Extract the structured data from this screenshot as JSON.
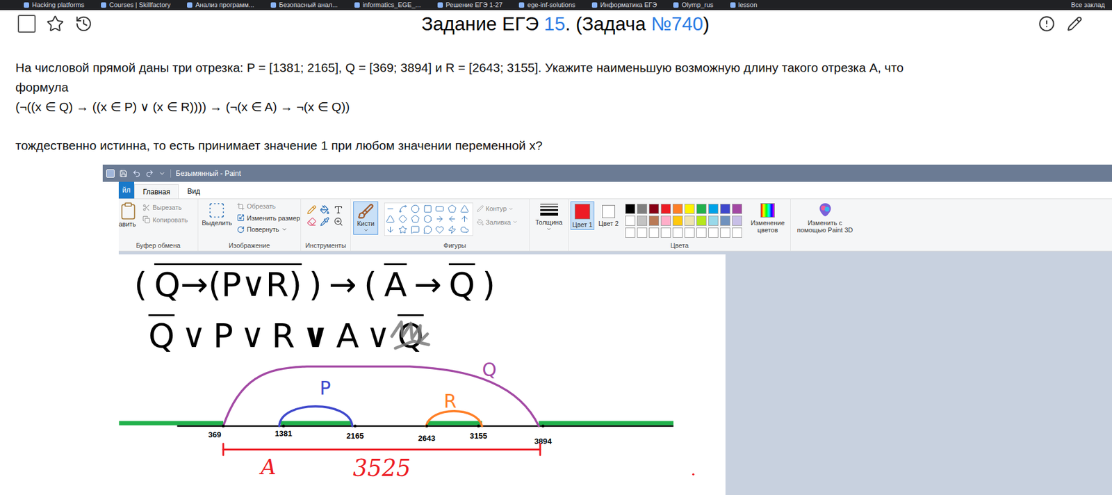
{
  "browser": {
    "bookmarks": [
      "Hacking platforms",
      "Courses | Skillfactory",
      "Анализ программ...",
      "Безопасный анал...",
      "informatics_EGE_...",
      "Решение ЕГЭ 1-27",
      "ege-inf-solutions",
      "Информатика ЕГЭ",
      "Olymp_rus",
      "lesson"
    ],
    "all_bookmarks": "Все заклад"
  },
  "page": {
    "title_prefix": "Задание ЕГЭ ",
    "title_number": "15",
    "title_middle": ". (Задача ",
    "title_task": "№740",
    "title_suffix": ")",
    "problem_lines": [
      "На числовой прямой даны три отрезка: P = [1381; 2165], Q = [369; 3894] и R = [2643; 3155]. Укажите наименьшую возможную длину такого отрезка A, что",
      "формула",
      "(¬((x ∈ Q) → ((x ∈ P) ∨ (x ∈ R)))) → (¬(x ∈ A) → ¬(x ∈ Q))"
    ],
    "question": "тождественно истинна, то есть принимает значение 1 при любом значении переменной x?",
    "checked": false
  },
  "paint": {
    "title": "Безымянный - Paint",
    "tabs": [
      {
        "label": "йл",
        "selected": false,
        "kind": "file"
      },
      {
        "label": "Главная",
        "selected": true,
        "kind": "tab"
      },
      {
        "label": "Вид",
        "selected": false,
        "kind": "tab"
      }
    ],
    "clipboard": {
      "label": "Буфер обмена",
      "paste": "авить",
      "cut": "Вырезать",
      "copy": "Копировать"
    },
    "image": {
      "label": "Изображение",
      "select": "Выделить",
      "crop": "Обрезать",
      "resize": "Изменить размер",
      "rotate": "Повернуть"
    },
    "tools": {
      "label": "Инструменты"
    },
    "brushes": {
      "label": "Кисти",
      "selected": true
    },
    "shapes": {
      "label": "Фигуры",
      "outline": "Контур",
      "fill": "Заливка"
    },
    "size": {
      "label": "Толщина"
    },
    "colors": {
      "label": "Цвета",
      "color1": {
        "label": "Цвет 1",
        "color": "#ed1c24",
        "selected": true
      },
      "color2": {
        "label": "Цвет 2",
        "color": "#ffffff",
        "selected": false
      },
      "palette": [
        "#000000",
        "#7f7f7f",
        "#880015",
        "#ed1c24",
        "#ff7f27",
        "#fff200",
        "#22b14c",
        "#00a2e8",
        "#3f48cc",
        "#a349a4",
        "#ffffff",
        "#c3c3c3",
        "#b97a57",
        "#ffaec9",
        "#ffc90e",
        "#efe4b0",
        "#b5e61d",
        "#99d9ea",
        "#7092be",
        "#c8bfe7",
        "#ffffff",
        "#ffffff",
        "#ffffff",
        "#ffffff",
        "#ffffff",
        "#ffffff",
        "#ffffff",
        "#ffffff",
        "#ffffff",
        "#ffffff"
      ],
      "edit": "Изменение цветов"
    },
    "paint3d": "Изменить с помощью Paint 3D",
    "drawing": {
      "formula_lines": [
        [
          {
            "text": "(",
            "negated": false,
            "scribbled": false,
            "bold": false
          },
          {
            "text": "Q→(P∨R)",
            "negated": true,
            "scribbled": false,
            "bold": false
          },
          {
            "text": ")",
            "negated": false,
            "scribbled": false,
            "bold": false
          },
          {
            "text": "→",
            "negated": false,
            "scribbled": false,
            "bold": false
          },
          {
            "text": "(",
            "negated": false,
            "scribbled": false,
            "bold": false
          },
          {
            "text": "A",
            "negated": true,
            "scribbled": false,
            "bold": false
          },
          {
            "text": "→",
            "negated": false,
            "scribbled": false,
            "bold": false
          },
          {
            "text": "Q",
            "negated": true,
            "scribbled": false,
            "bold": false
          },
          {
            "text": ")",
            "negated": false,
            "scribbled": false,
            "bold": false
          }
        ],
        [
          {
            "text": "Q",
            "negated": true,
            "scribbled": false,
            "bold": false
          },
          {
            "text": "∨",
            "negated": false,
            "scribbled": false,
            "bold": false
          },
          {
            "text": "P",
            "negated": false,
            "scribbled": false,
            "bold": false
          },
          {
            "text": "∨",
            "negated": false,
            "scribbled": false,
            "bold": false
          },
          {
            "text": "R",
            "negated": false,
            "scribbled": false,
            "bold": false
          },
          {
            "text": "∨",
            "negated": false,
            "scribbled": false,
            "bold": true
          },
          {
            "text": "A",
            "negated": false,
            "scribbled": false,
            "bold": false
          },
          {
            "text": "∨",
            "negated": false,
            "scribbled": false,
            "bold": false
          },
          {
            "text": "Q",
            "negated": true,
            "scribbled": true,
            "bold": false
          }
        ]
      ],
      "arcs": [
        {
          "label": "Q",
          "color": "#a349a4"
        },
        {
          "label": "P",
          "color": "#3f48cc"
        },
        {
          "label": "R",
          "color": "#ff7f27"
        }
      ],
      "truth_color": "#22b14c",
      "ticks": [
        "369",
        "1381",
        "2165",
        "2643",
        "3155",
        "3894"
      ],
      "answer": {
        "label": "A",
        "length": "3525",
        "color": "#ed1c24"
      }
    }
  }
}
